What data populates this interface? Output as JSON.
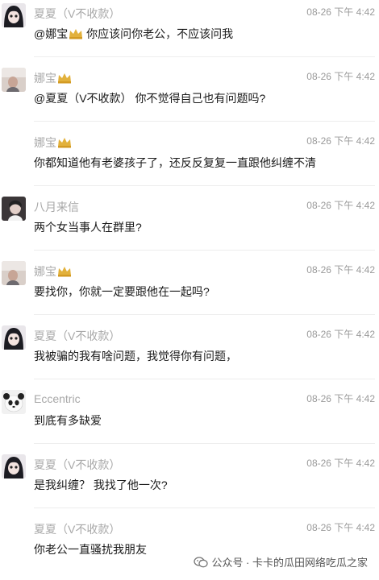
{
  "messages": [
    {
      "avatar": "xiaxia-avatar",
      "name": "夏夏（V不收款）",
      "time": "08-26 下午 4:42",
      "text_pre": "@娜宝",
      "text_post": "  你应该问你老公，不应该问我",
      "crown_in_text": true
    },
    {
      "avatar": "nabao-avatar",
      "name": "娜宝",
      "crown": true,
      "time": "08-26 下午 4:42",
      "text": "@夏夏（V不收款）  你不觉得自己也有问题吗?"
    },
    {
      "avatar": "none",
      "name": "娜宝",
      "crown": true,
      "time": "08-26 下午 4:42",
      "text": "你都知道他有老婆孩子了，还反反复复一直跟他纠缠不清"
    },
    {
      "avatar": "bayue-avatar",
      "name": "八月来信",
      "time": "08-26 下午 4:42",
      "text": "两个女当事人在群里?"
    },
    {
      "avatar": "nabao-avatar",
      "name": "娜宝",
      "crown": true,
      "time": "08-26 下午 4:42",
      "text": "要找你，你就一定要跟他在一起吗?"
    },
    {
      "avatar": "xiaxia-avatar",
      "name": "夏夏（V不收款）",
      "time": "08-26 下午 4:42",
      "text": "我被骗的我有啥问题，我觉得你有问题，"
    },
    {
      "avatar": "eccentric-avatar",
      "name": "Eccentric",
      "time": "08-26 下午 4:42",
      "text": "到底有多缺爱"
    },
    {
      "avatar": "xiaxia-avatar",
      "name": "夏夏（V不收款）",
      "time": "08-26 下午 4:42",
      "text": "是我纠缠？ 我找了他一次?"
    },
    {
      "avatar": "none",
      "name": "夏夏（V不收款）",
      "time": "08-26 下午 4:42",
      "text": "你老公一直骚扰我朋友"
    }
  ],
  "watermark": {
    "text": "公众号 · 卡卡的瓜田网络吃瓜之家",
    "icon": "wechat-official-account-icon"
  },
  "colors": {
    "name": "#a8a8a8",
    "time": "#9a9a9a",
    "text": "#1a1a1a",
    "crown": "#e2b13c",
    "separator": "#ededed"
  }
}
